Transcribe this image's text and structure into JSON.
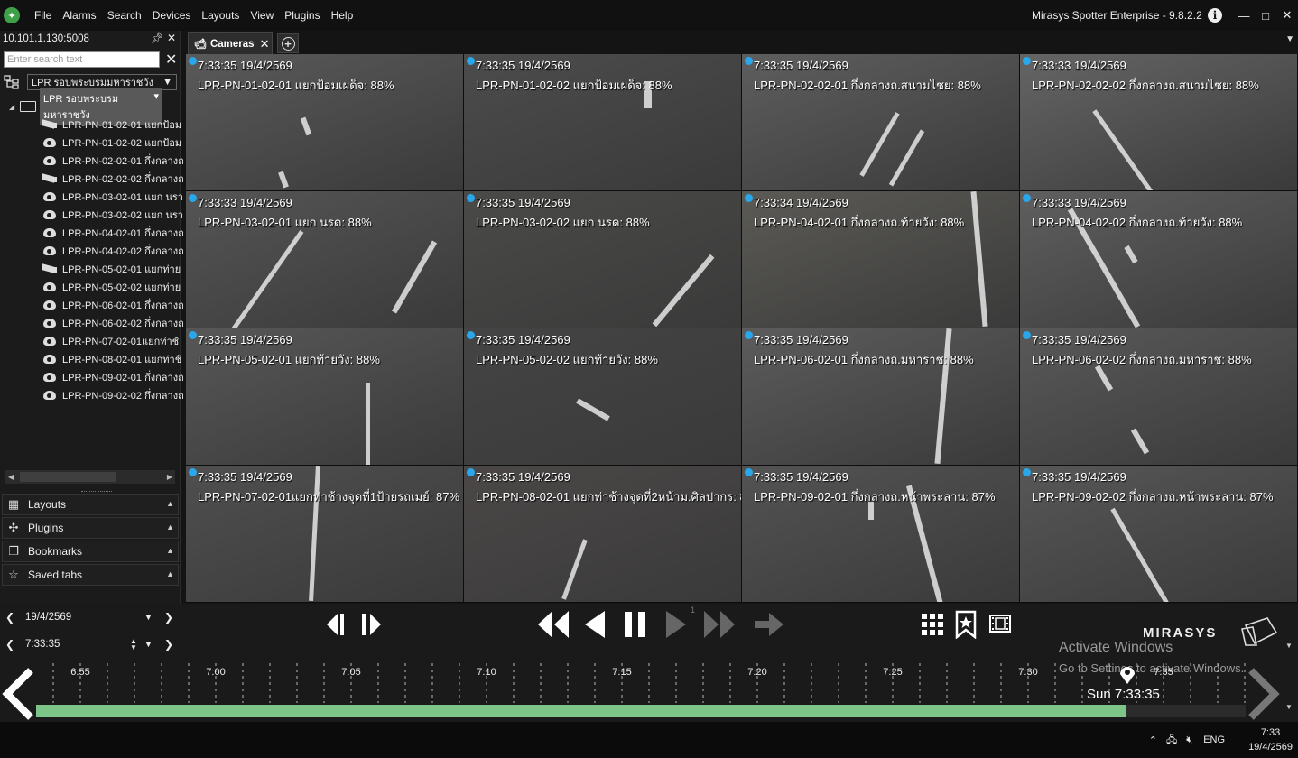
{
  "menu": {
    "items": [
      "File",
      "Alarms",
      "Search",
      "Devices",
      "Layouts",
      "View",
      "Plugins",
      "Help"
    ],
    "app_title": "Mirasys Spotter Enterprise - 9.8.2.2",
    "info_glyph": "i",
    "win_minimize": "—",
    "win_maximize": "□",
    "win_close": "✕"
  },
  "left_panel": {
    "server": "10.101.1.130:5008",
    "search_placeholder": "Enter search text",
    "group_select": "LPR รอบพระบรมมหาราชวัง",
    "tree_root": "LPR รอบพระบรมมหาราชวัง",
    "cameras": [
      {
        "label": "LPR-PN-01-02-01 แยกป้อม",
        "icon": "box"
      },
      {
        "label": "LPR-PN-01-02-02 แยกป้อม",
        "icon": "dome"
      },
      {
        "label": "LPR-PN-02-02-01 กึ่งกลางถ",
        "icon": "dome"
      },
      {
        "label": "LPR-PN-02-02-02 กึ่งกลางถ",
        "icon": "box"
      },
      {
        "label": "LPR-PN-03-02-01 แยก นรา",
        "icon": "dome"
      },
      {
        "label": "LPR-PN-03-02-02 แยก นรา",
        "icon": "dome"
      },
      {
        "label": "LPR-PN-04-02-01 กึ่งกลางถ",
        "icon": "dome"
      },
      {
        "label": "LPR-PN-04-02-02 กึ่งกลางถ",
        "icon": "dome"
      },
      {
        "label": "LPR-PN-05-02-01 แยกท่าย",
        "icon": "box"
      },
      {
        "label": "LPR-PN-05-02-02 แยกท่าย",
        "icon": "dome"
      },
      {
        "label": "LPR-PN-06-02-01 กึ่งกลางถ",
        "icon": "dome"
      },
      {
        "label": "LPR-PN-06-02-02 กึ่งกลางถ",
        "icon": "dome"
      },
      {
        "label": "LPR-PN-07-02-01แยกท่าช้",
        "icon": "dome"
      },
      {
        "label": "LPR-PN-08-02-01 แยกท่าช้",
        "icon": "dome"
      },
      {
        "label": "LPR-PN-09-02-01 กึ่งกลางถ",
        "icon": "dome"
      },
      {
        "label": "LPR-PN-09-02-02 กึ่งกลางถ",
        "icon": "dome"
      }
    ],
    "panels": [
      {
        "label": "Layouts",
        "icon": "grid-icon",
        "glyph": "▦"
      },
      {
        "label": "Plugins",
        "icon": "puzzle-icon",
        "glyph": "✣"
      },
      {
        "label": "Bookmarks",
        "icon": "bookmark-icon",
        "glyph": "❐"
      },
      {
        "label": "Saved tabs",
        "icon": "saved-tabs-icon",
        "glyph": "☆"
      }
    ]
  },
  "tabs": {
    "active": "Cameras",
    "close_glyph": "✕",
    "add_glyph": "+"
  },
  "grid": {
    "cells": [
      {
        "time": "7:33:35  19/4/2569",
        "name": "LPR-PN-01-02-01 แยกป้อมเผด็จ: 88%",
        "tone": "#5a5a5a"
      },
      {
        "time": "7:33:35  19/4/2569",
        "name": "LPR-PN-01-02-02 แยกป้อมเผด็จ: 88%",
        "tone": "#4c4c4c"
      },
      {
        "time": "7:33:35  19/4/2569",
        "name": "LPR-PN-02-02-01 กึ่งกลางถ.สนามไชย: 88%",
        "tone": "#5e5e5e"
      },
      {
        "time": "7:33:33  19/4/2569",
        "name": "LPR-PN-02-02-02 กึ่งกลางถ.สนามไชย: 88%",
        "tone": "#656565"
      },
      {
        "time": "7:33:33  19/4/2569",
        "name": "LPR-PN-03-02-01 แยก นรด: 88%",
        "tone": "#555555"
      },
      {
        "time": "7:33:35  19/4/2569",
        "name": "LPR-PN-03-02-02 แยก นรด: 88%",
        "tone": "#4a4a48"
      },
      {
        "time": "7:33:34  19/4/2569",
        "name": "LPR-PN-04-02-01 กึ่งกลางถ.ท้ายวัง: 88%",
        "tone": "#5b5a55"
      },
      {
        "time": "7:33:33  19/4/2569",
        "name": "LPR-PN-04-02-02 กึ่งกลางถ.ท้ายวัง: 88%",
        "tone": "#5f5f5f"
      },
      {
        "time": "7:33:35  19/4/2569",
        "name": "LPR-PN-05-02-01 แยกท้ายวัง: 88%",
        "tone": "#575757"
      },
      {
        "time": "7:33:35  19/4/2569",
        "name": "LPR-PN-05-02-02 แยกท้ายวัง: 88%",
        "tone": "#444444"
      },
      {
        "time": "7:33:35  19/4/2569",
        "name": "LPR-PN-06-02-01 กึ่งกลางถ.มหาราช: 88%",
        "tone": "#5c5c5c"
      },
      {
        "time": "7:33:35  19/4/2569",
        "name": "LPR-PN-06-02-02 กึ่งกลางถ.มหาราช: 88%",
        "tone": "#595959"
      },
      {
        "time": "7:33:35  19/4/2569",
        "name": "LPR-PN-07-02-01แยกท่าช้างจุดที่1ป้ายรถเมย์: 87%",
        "tone": "#4f4f4f"
      },
      {
        "time": "7:33:35  19/4/2569",
        "name": "LPR-PN-08-02-01 แยกท่าช้างจุดที่2หน้าม.ศิลปากร: 8",
        "tone": "#4b4747"
      },
      {
        "time": "7:33:35  19/4/2569",
        "name": "LPR-PN-09-02-01 กึ่งกลางถ.หน้าพระลาน: 87%",
        "tone": "#535353"
      },
      {
        "time": "7:33:35  19/4/2569",
        "name": "LPR-PN-09-02-02 กึ่งกลางถ.หน้าพระลาน: 87%",
        "tone": "#575757"
      }
    ]
  },
  "playback": {
    "date": "19/4/2569",
    "time": "7:33:35",
    "speed_indicator": "1",
    "brand": "MIRASYS",
    "watermark_title": "Activate Windows",
    "watermark_sub": "Go to Settings to activate Windows."
  },
  "timeline": {
    "ticks": [
      "6:55",
      "7:00",
      "7:05",
      "7:10",
      "7:15",
      "7:20",
      "7:25",
      "7:30",
      "7:35"
    ],
    "cursor_label": "Sun 7:33:35",
    "recorded_color": "#7cc487"
  },
  "taskbar": {
    "lang": "ENG",
    "clock_time": "7:33",
    "clock_date": "19/4/2569"
  }
}
